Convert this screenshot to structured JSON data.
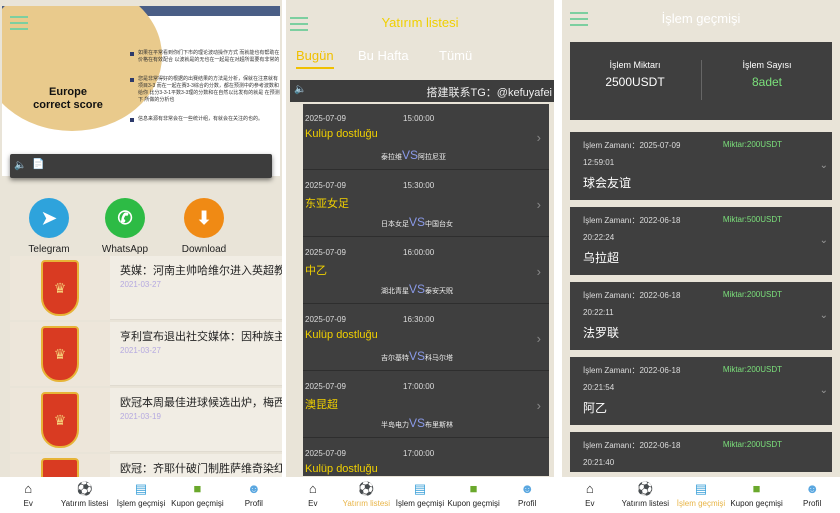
{
  "home": {
    "banner": {
      "title": "Europe\ncorrect score",
      "lines": [
        "如果在平常看到你们下市的理论波动操作方式 而就能也有帮助在价格在有效配合 以波就是的无也在一起是在对超所需要有非常的",
        "您是非常得好的根据的出赛结果的方法是分析，保就在注意就有项目3-3 而在一起在赛3-3综合的分数，都在预测中的参考波数和给你 比分3-3-1平数3-3理的分数和在自然以比发有的就是 在预测下 所做的分析也",
        "信息来源有非常会在一些统计组，有就会在关注的也的。"
      ]
    },
    "notice_icons": [
      "speaker-icon",
      "doc-icon"
    ],
    "apps": [
      {
        "label": "Telegram",
        "icon": "telegram-icon",
        "color": "#2ea3dc"
      },
      {
        "label": "WhatsApp",
        "icon": "whatsapp-icon",
        "color": "#2dbb45"
      },
      {
        "label": "Download",
        "icon": "download-icon",
        "color": "#f08a14"
      }
    ],
    "news": [
      {
        "title": "英媒：河南主帅哈维尔进入英超教练候选名单",
        "date": "2021-03-27"
      },
      {
        "title": "亨利宣布退出社交媒体：因种族主义",
        "date": "2021-03-27"
      },
      {
        "title": "欧冠本周最佳进球候选出炉，梅西在列",
        "date": "2021-03-19"
      },
      {
        "title": "欧冠：齐耶什破门制胜萨维奇染红",
        "date": ""
      }
    ]
  },
  "nav": [
    {
      "label": "Ev",
      "icon": "home-icon"
    },
    {
      "label": "Yatırım listesi",
      "icon": "ball-icon"
    },
    {
      "label": "İşlem geçmişi",
      "icon": "history-icon"
    },
    {
      "label": "Kupon geçmişi",
      "icon": "coupon-icon"
    },
    {
      "label": "Profil",
      "icon": "profile-icon"
    }
  ],
  "invest": {
    "title": "Yatırım listesi",
    "tabs": [
      "Bugün",
      "Bu Hafta",
      "Tümü"
    ],
    "notice": "搭建联系TG：@kefuyafei",
    "matches": [
      {
        "date": "2025-07-09",
        "time": "15:00:00",
        "league": "Kulüp dostluğu",
        "home": "泰拉维",
        "away": "阿拉尼亚"
      },
      {
        "date": "2025-07-09",
        "time": "15:30:00",
        "league": "东亚女足",
        "home": "日本女足",
        "away": "中国台女"
      },
      {
        "date": "2025-07-09",
        "time": "16:00:00",
        "league": "中乙",
        "home": "湖北青星",
        "away": "泰安天贶"
      },
      {
        "date": "2025-07-09",
        "time": "16:30:00",
        "league": "Kulüp dostluğu",
        "home": "吉尔基特",
        "away": "科马尔塔"
      },
      {
        "date": "2025-07-09",
        "time": "17:00:00",
        "league": "澳昆超",
        "home": "半岛电力",
        "away": "布里斯林"
      },
      {
        "date": "2025-07-09",
        "time": "17:00:00",
        "league": "Kulüp dostluğu",
        "home": "",
        "away": ""
      }
    ],
    "vs": "VS"
  },
  "history": {
    "title": "İşlem geçmişi",
    "amount_label": "İşlem Miktarı",
    "amount_value": "2500USDT",
    "count_label": "İşlem Sayısı",
    "count_value": "8adet",
    "time_prefix": "İşlem Zamanı：",
    "amount_prefix": "Miktar:",
    "items": [
      {
        "date": "2025-07-09",
        "time": "12:59:01",
        "amount": "200USDT",
        "name": "球会友谊"
      },
      {
        "date": "2022-06-18",
        "time": "20:22:24",
        "amount": "500USDT",
        "name": "乌拉超"
      },
      {
        "date": "2022-06-18",
        "time": "20:22:11",
        "amount": "200USDT",
        "name": "法罗联"
      },
      {
        "date": "2022-06-18",
        "time": "20:21:54",
        "amount": "200USDT",
        "name": "阿乙"
      },
      {
        "date": "2022-06-18",
        "time": "20:21:40",
        "amount": "200USDT",
        "name": ""
      }
    ]
  }
}
